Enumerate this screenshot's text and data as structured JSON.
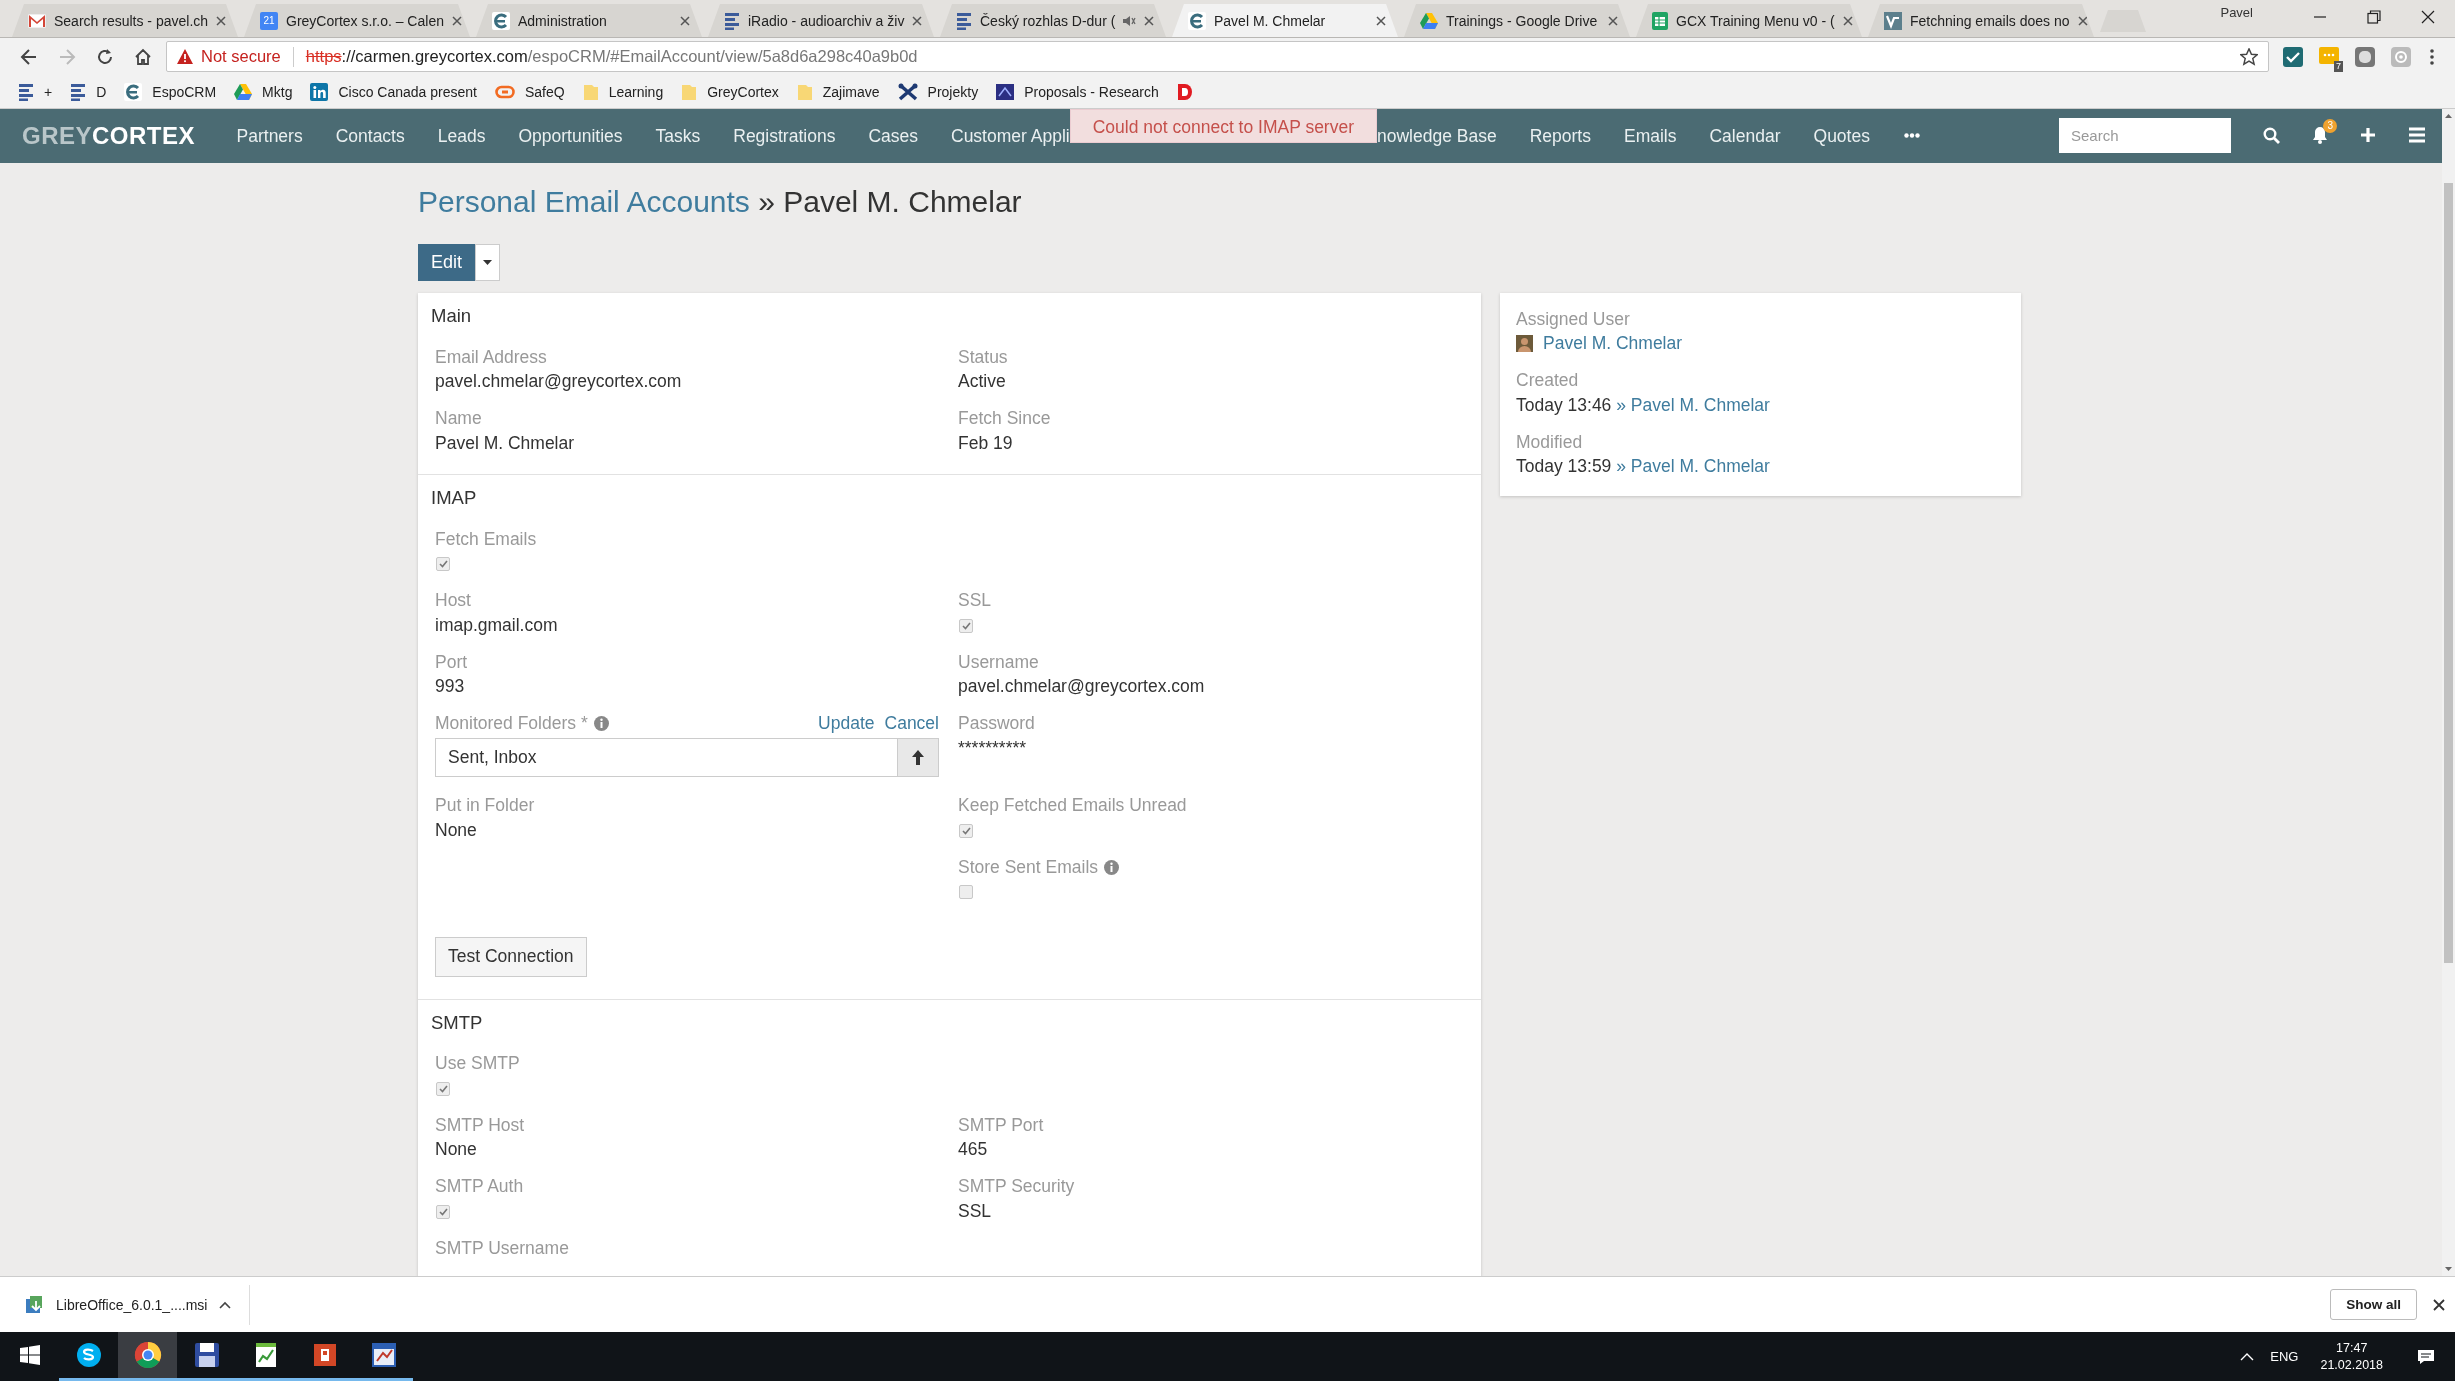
{
  "browser": {
    "tabs": [
      {
        "title": "Search results - pavel.ch",
        "kind": "mail",
        "selected": false,
        "audio": false
      },
      {
        "title": "GreyCortex s.r.o. – Calen",
        "kind": "calendar",
        "icon_text": "21",
        "selected": false,
        "audio": false
      },
      {
        "title": "Administration",
        "kind": "logo",
        "selected": false,
        "audio": false
      },
      {
        "title": "iRadio - audioarchiv a živ",
        "kind": "list",
        "selected": false,
        "audio": false
      },
      {
        "title": "Český rozhlas D-dur (",
        "kind": "list",
        "selected": false,
        "audio": true
      },
      {
        "title": "Pavel M. Chmelar",
        "kind": "logo",
        "selected": true,
        "audio": false
      },
      {
        "title": "Trainings - Google Drive",
        "kind": "drive",
        "selected": false,
        "audio": false
      },
      {
        "title": "GCX Training Menu v0 - (",
        "kind": "sheet",
        "selected": false,
        "audio": false
      },
      {
        "title": "Fetchning emails does no",
        "kind": "page",
        "selected": false,
        "audio": false
      }
    ],
    "profile": "Pavel",
    "back_disabled": false,
    "forward_disabled": true,
    "security": "Not secure",
    "url": {
      "scheme": "https",
      "host": "://carmen.greycortex.com",
      "path": "/espoCRM/#EmailAccount/view/5a8d6a298c40a9b0d"
    },
    "extension_badge": "7",
    "bookmarks": [
      {
        "label": "+",
        "kind": "list"
      },
      {
        "label": "D",
        "kind": "list"
      },
      {
        "label": "EspoCRM",
        "kind": "logo"
      },
      {
        "label": "Mktg",
        "kind": "drive"
      },
      {
        "label": "Cisco Canada present",
        "kind": "linkedin"
      },
      {
        "label": "SafeQ",
        "kind": "link"
      },
      {
        "label": "Learning",
        "kind": "folder"
      },
      {
        "label": "GreyCortex",
        "kind": "folder"
      },
      {
        "label": "Zajimave",
        "kind": "folder"
      },
      {
        "label": "Projekty",
        "kind": "tool"
      },
      {
        "label": "Proposals - Research",
        "kind": "book"
      },
      {
        "kind": "red"
      }
    ]
  },
  "app": {
    "logo": [
      "GREY",
      "CORTEX"
    ],
    "nav": [
      "Partners",
      "Contacts",
      "Leads",
      "Opportunities",
      "Tasks",
      "Registrations",
      "Cases",
      "Customer Appli"
    ],
    "notification": "Could not connect to IMAP server",
    "nav_more": [
      "nowledge Base",
      "Reports",
      "Emails",
      "Calendar",
      "Quotes"
    ],
    "search": {
      "placeholder": "Search"
    },
    "notification_count": "3"
  },
  "record": {
    "breadcrumb": {
      "parent": "Personal Email Accounts",
      "separator": "»",
      "current": "Pavel M. Chmelar"
    },
    "edit_button": "Edit",
    "sections": [
      {
        "title": "Main",
        "rows": [
          [
            {
              "kind": "text",
              "label": "Email Address",
              "value": "pavel.chmelar@greycortex.com",
              "info": false
            },
            {
              "kind": "text",
              "label": "Status",
              "value": "Active",
              "info": false
            }
          ],
          [
            {
              "kind": "text",
              "label": "Name",
              "value": "Pavel M. Chmelar",
              "info": false
            },
            {
              "kind": "text",
              "label": "Fetch Since",
              "value": "Feb 19",
              "info": false
            }
          ]
        ]
      },
      {
        "title": "IMAP",
        "rows": [
          [
            {
              "kind": "checkbox",
              "label": "Fetch Emails",
              "checked": true,
              "info": false
            },
            null
          ],
          [
            {
              "kind": "text",
              "label": "Host",
              "value": "imap.gmail.com",
              "info": false
            },
            {
              "kind": "checkbox",
              "label": "SSL",
              "checked": true,
              "info": false
            }
          ],
          [
            {
              "kind": "text",
              "label": "Port",
              "value": "993",
              "info": false
            },
            {
              "kind": "text",
              "label": "Username",
              "value": "pavel.chmelar@greycortex.com",
              "info": false
            }
          ],
          [
            {
              "kind": "folders",
              "label": "Monitored Folders *",
              "info": true,
              "actions": [
                "Update",
                "Cancel"
              ],
              "value": "Sent, Inbox"
            },
            {
              "kind": "text",
              "label": "Password",
              "value": "**********",
              "info": false
            }
          ],
          [
            {
              "kind": "text",
              "label": "Put in Folder",
              "value": "None",
              "info": false
            },
            {
              "kind": "checkbox",
              "label": "Keep Fetched Emails Unread",
              "checked": true,
              "info": false
            }
          ],
          [
            null,
            {
              "kind": "checkbox",
              "label": "Store Sent Emails",
              "checked": false,
              "info": true
            }
          ]
        ],
        "button": "Test Connection"
      },
      {
        "title": "SMTP",
        "rows": [
          [
            {
              "kind": "checkbox",
              "label": "Use SMTP",
              "checked": true,
              "info": false
            },
            null
          ],
          [
            {
              "kind": "text",
              "label": "SMTP Host",
              "value": "None",
              "info": false
            },
            {
              "kind": "text",
              "label": "SMTP Port",
              "value": "465",
              "info": false
            }
          ],
          [
            {
              "kind": "checkbox",
              "label": "SMTP Auth",
              "checked": true,
              "info": false
            },
            {
              "kind": "text",
              "label": "SMTP Security",
              "value": "SSL",
              "info": false
            }
          ],
          [
            {
              "kind": "label",
              "label": "SMTP Username",
              "info": false
            },
            null
          ]
        ]
      }
    ],
    "side": [
      {
        "kind": "user",
        "label": "Assigned User",
        "user": "Pavel M. Chmelar"
      },
      {
        "kind": "stamp",
        "label": "Created",
        "time": "Today 13:46",
        "separator": "»",
        "user": "Pavel M. Chmelar"
      },
      {
        "kind": "stamp",
        "label": "Modified",
        "time": "Today 13:59",
        "separator": "»",
        "user": "Pavel M. Chmelar"
      }
    ]
  },
  "download": {
    "file": "LibreOffice_6.0.1_....msi",
    "show_all": "Show all"
  },
  "taskbar": {
    "apps": [
      {
        "kind": "skype",
        "running": true,
        "selected": false
      },
      {
        "kind": "chrome",
        "running": true,
        "selected": true
      },
      {
        "kind": "disk",
        "running": true,
        "selected": false
      },
      {
        "kind": "sheet",
        "running": true,
        "selected": false
      },
      {
        "kind": "slides",
        "running": true,
        "selected": false
      },
      {
        "kind": "editor",
        "running": true,
        "selected": false
      }
    ],
    "language": "ENG",
    "time": "17:47",
    "date": "21.02.2018"
  }
}
